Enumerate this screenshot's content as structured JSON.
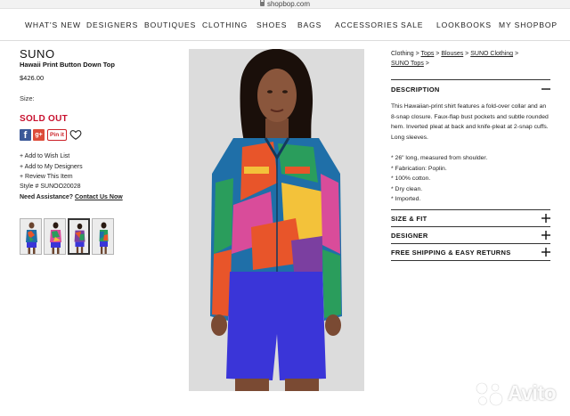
{
  "browser": {
    "url": "shopbop.com"
  },
  "nav": {
    "items": [
      "WHAT'S NEW",
      "DESIGNERS",
      "BOUTIQUES",
      "CLOTHING",
      "SHOES",
      "BAGS",
      "ACCESSORIES",
      "SALE",
      "LOOKBOOKS",
      "MY SHOPBOP"
    ]
  },
  "product": {
    "brand": "SUNO",
    "title": "Hawaii Print Button Down Top",
    "price": "$426.00",
    "size_label": "Size:",
    "status": "SOLD OUT",
    "pin_label": "Pin it",
    "links": [
      "+ Add to Wish List",
      "+ Add to My Designers",
      "+ Review This Item"
    ],
    "style_number": "Style # SUNOO20028",
    "assist_prefix": "Need Assistance?",
    "assist_link": "Contact Us Now",
    "thumbnail_count": 4,
    "selected_thumbnail": 3
  },
  "breadcrumb": [
    {
      "text": "Clothing",
      "sep": " > "
    },
    {
      "text": "Tops",
      "sep": " > ",
      "underline": true
    },
    {
      "text": "Blouses",
      "sep": " > ",
      "underline": true
    },
    {
      "text": "SUNO Clothing",
      "sep": " >",
      "underline": true
    },
    {
      "text": "SUNO Tops",
      "sep": " >",
      "underline": true
    }
  ],
  "details": {
    "description_heading": "DESCRIPTION",
    "description_text": "This Hawaiian-print shirt features a fold-over collar and an 8-snap closure. Faux-flap bust pockets and subtle rounded hem. Inverted pleat at back and knife-pleat at 2-snap cuffs. Long sleeves.",
    "bullets": [
      "* 26\" long, measured from shoulder.",
      "* Fabrication: Poplin.",
      "* 100% cotton.",
      "* Dry clean.",
      "* Imported."
    ],
    "sections": [
      "SIZE & FIT",
      "DESIGNER",
      "FREE SHIPPING & EASY RETURNS"
    ]
  },
  "watermark": {
    "text": "Avito"
  },
  "colors": {
    "sold_out": "#c8102e",
    "facebook": "#3b5998",
    "google_plus": "#dd4b39",
    "pinterest": "#cb2027",
    "shirt_print": [
      "#1f6fa8",
      "#e8552a",
      "#2a9d5c",
      "#d94c9a",
      "#f3c23a",
      "#7b3fa0"
    ],
    "shorts": "#3a35d8"
  },
  "icons": [
    "lock-icon",
    "facebook-icon",
    "google-plus-icon",
    "pinterest-icon",
    "heart-icon",
    "minus-icon",
    "plus-icon",
    "avito-logo"
  ]
}
